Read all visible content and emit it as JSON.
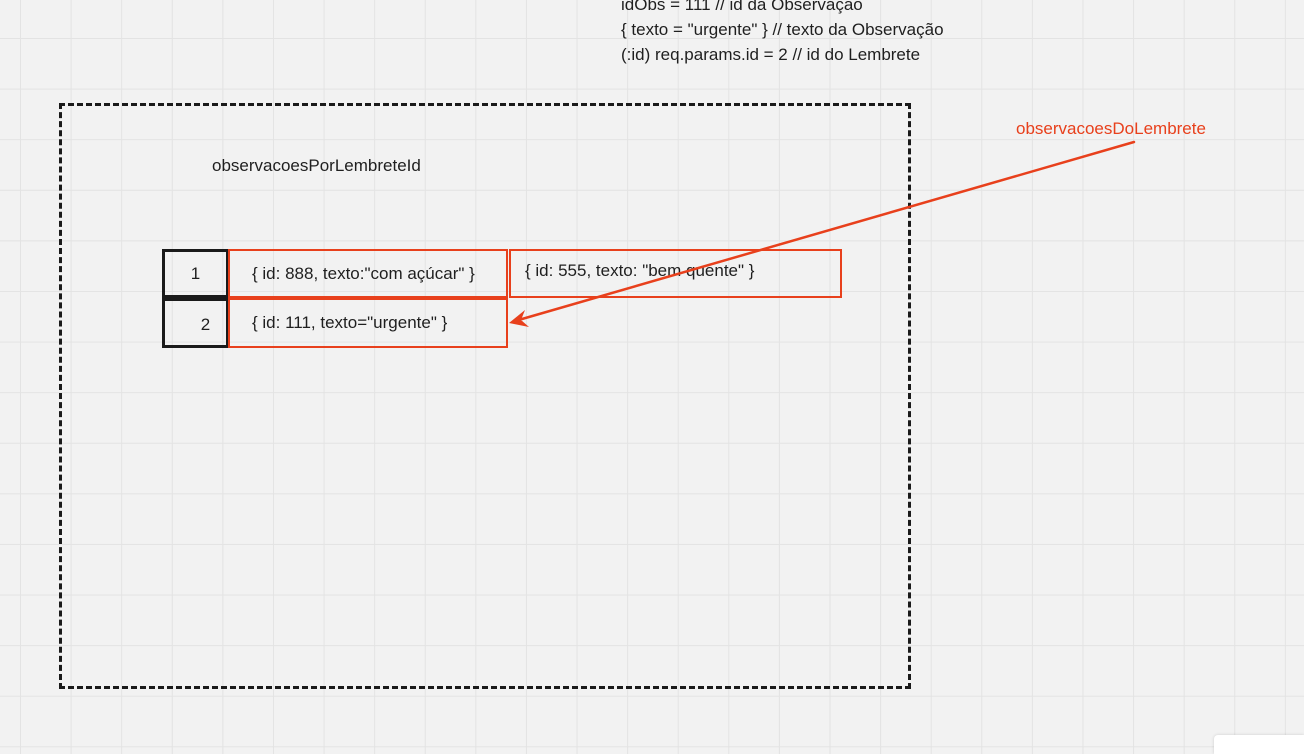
{
  "notes": {
    "line1": "idObs = 111 // id da Observação",
    "line2": "{ texto = \"urgente\" } // texto da Observação",
    "line3": "(:id) req.params.id = 2 // id do Lembrete"
  },
  "map_title": "observacoesPorLembreteId",
  "rows": [
    {
      "key": "1",
      "values": [
        "{ id: 888, texto:\"com açúcar\" }",
        "{ id: 555, texto: \"bem quente\" }"
      ]
    },
    {
      "key": "2",
      "values": [
        "{ id: 111, texto=\"urgente\" }"
      ]
    }
  ],
  "pointer_label": "observacoesDoLembrete",
  "colors": {
    "accent": "#e8401c",
    "frame": "#1a1a1a",
    "grid": "#e3e3e3",
    "background": "#f2f2f2"
  }
}
